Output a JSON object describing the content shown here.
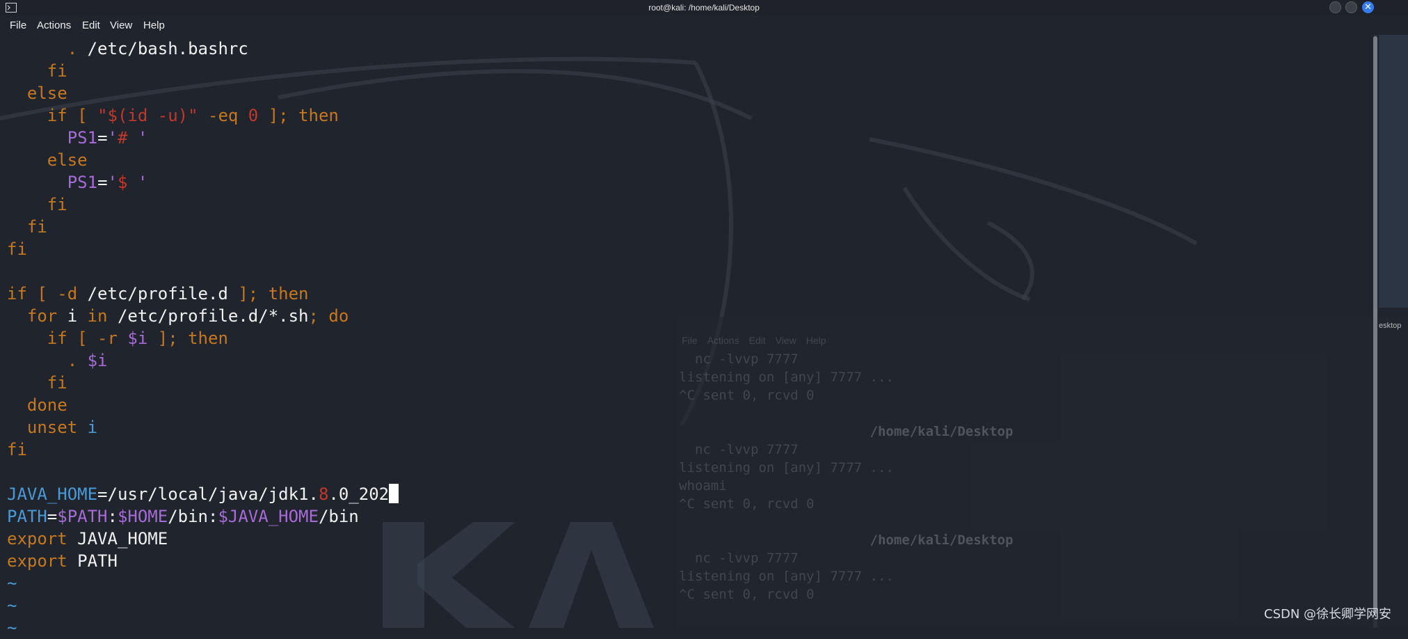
{
  "window": {
    "title": "root@kali: /home/kali/Desktop"
  },
  "menu": [
    "File",
    "Actions",
    "Edit",
    "View",
    "Help"
  ],
  "lines": [
    {
      "tokens": [
        {
          "t": "      ",
          "c": ""
        },
        {
          "t": ".",
          "c": "k"
        },
        {
          "t": " /etc/bash.bashrc",
          "c": ""
        }
      ]
    },
    {
      "tokens": [
        {
          "t": "    fi",
          "c": "k"
        }
      ]
    },
    {
      "tokens": [
        {
          "t": "  else",
          "c": "k"
        }
      ]
    },
    {
      "tokens": [
        {
          "t": "    if [ ",
          "c": "k"
        },
        {
          "t": "\"$(id -u)\"",
          "c": "s"
        },
        {
          "t": " -eq ",
          "c": "k"
        },
        {
          "t": "0",
          "c": "s"
        },
        {
          "t": " ]; then",
          "c": "k"
        }
      ]
    },
    {
      "tokens": [
        {
          "t": "      ",
          "c": ""
        },
        {
          "t": "PS1",
          "c": "v"
        },
        {
          "t": "=",
          "c": ""
        },
        {
          "t": "'",
          "c": "v"
        },
        {
          "t": "#",
          "c": "s"
        },
        {
          "t": " '",
          "c": "v"
        }
      ]
    },
    {
      "tokens": [
        {
          "t": "    else",
          "c": "k"
        }
      ]
    },
    {
      "tokens": [
        {
          "t": "      ",
          "c": ""
        },
        {
          "t": "PS1",
          "c": "v"
        },
        {
          "t": "=",
          "c": ""
        },
        {
          "t": "'",
          "c": "v"
        },
        {
          "t": "$",
          "c": "s"
        },
        {
          "t": " '",
          "c": "v"
        }
      ]
    },
    {
      "tokens": [
        {
          "t": "    fi",
          "c": "k"
        }
      ]
    },
    {
      "tokens": [
        {
          "t": "  fi",
          "c": "k"
        }
      ]
    },
    {
      "tokens": [
        {
          "t": "fi",
          "c": "k"
        }
      ]
    },
    {
      "tokens": [
        {
          "t": "",
          "c": ""
        }
      ]
    },
    {
      "tokens": [
        {
          "t": "if [ -d ",
          "c": "k"
        },
        {
          "t": "/etc/profile.d",
          "c": ""
        },
        {
          "t": " ]; then",
          "c": "k"
        }
      ]
    },
    {
      "tokens": [
        {
          "t": "  for ",
          "c": "k"
        },
        {
          "t": "i",
          "c": ""
        },
        {
          "t": " in ",
          "c": "k"
        },
        {
          "t": "/etc/profile.d/*.sh",
          "c": ""
        },
        {
          "t": "; do",
          "c": "k"
        }
      ]
    },
    {
      "tokens": [
        {
          "t": "    if [ -r ",
          "c": "k"
        },
        {
          "t": "$i",
          "c": "v"
        },
        {
          "t": " ]; then",
          "c": "k"
        }
      ]
    },
    {
      "tokens": [
        {
          "t": "      ",
          "c": ""
        },
        {
          "t": ".",
          "c": "k"
        },
        {
          "t": " ",
          "c": ""
        },
        {
          "t": "$i",
          "c": "v"
        }
      ]
    },
    {
      "tokens": [
        {
          "t": "    fi",
          "c": "k"
        }
      ]
    },
    {
      "tokens": [
        {
          "t": "  done",
          "c": "k"
        }
      ]
    },
    {
      "tokens": [
        {
          "t": "  unset ",
          "c": "k"
        },
        {
          "t": "i",
          "c": "b"
        }
      ]
    },
    {
      "tokens": [
        {
          "t": "fi",
          "c": "k"
        }
      ]
    },
    {
      "tokens": [
        {
          "t": "",
          "c": ""
        }
      ]
    },
    {
      "tokens": [
        {
          "t": "JAVA_HOME",
          "c": "b"
        },
        {
          "t": "=/usr/local/java/jdk1.",
          "c": ""
        },
        {
          "t": "8",
          "c": "s"
        },
        {
          "t": ".0_202",
          "c": ""
        }
      ],
      "cursor": true
    },
    {
      "tokens": [
        {
          "t": "PATH",
          "c": "b"
        },
        {
          "t": "=",
          "c": ""
        },
        {
          "t": "$PATH",
          "c": "v"
        },
        {
          "t": ":",
          "c": ""
        },
        {
          "t": "$HOME",
          "c": "v"
        },
        {
          "t": "/bin:",
          "c": ""
        },
        {
          "t": "$JAVA_HOME",
          "c": "v"
        },
        {
          "t": "/bin",
          "c": ""
        }
      ]
    },
    {
      "tokens": [
        {
          "t": "export ",
          "c": "k"
        },
        {
          "t": "JAVA_HOME",
          "c": ""
        }
      ]
    },
    {
      "tokens": [
        {
          "t": "export ",
          "c": "k"
        },
        {
          "t": "PATH",
          "c": ""
        }
      ]
    },
    {
      "tokens": [
        {
          "t": "~",
          "c": "b"
        }
      ]
    },
    {
      "tokens": [
        {
          "t": "~",
          "c": "b"
        }
      ]
    },
    {
      "tokens": [
        {
          "t": "~",
          "c": "b"
        }
      ]
    }
  ],
  "background_window": {
    "title": "esktop",
    "menu": [
      "File",
      "Actions",
      "Edit",
      "View",
      "Help"
    ],
    "lines": [
      "  nc -lvvp 7777",
      "listening on [any] 7777 ...",
      "^C sent 0, rcvd 0",
      "",
      "                        /home/kali/Desktop",
      "  nc -lvvp 7777",
      "listening on [any] 7777 ...",
      "whoami",
      "^C sent 0, rcvd 0",
      "",
      "                        /home/kali/Desktop",
      "  nc -lvvp 7777",
      "listening on [any] 7777 ...",
      "^C sent 0, rcvd 0"
    ]
  },
  "watermark": "CSDN @徐长卿学网安",
  "colors": {
    "keyword": "#c6781e",
    "string": "#c0392b",
    "variable": "#a66bd6",
    "identifier": "#4a9ad8",
    "close_button": "#367bf0"
  }
}
